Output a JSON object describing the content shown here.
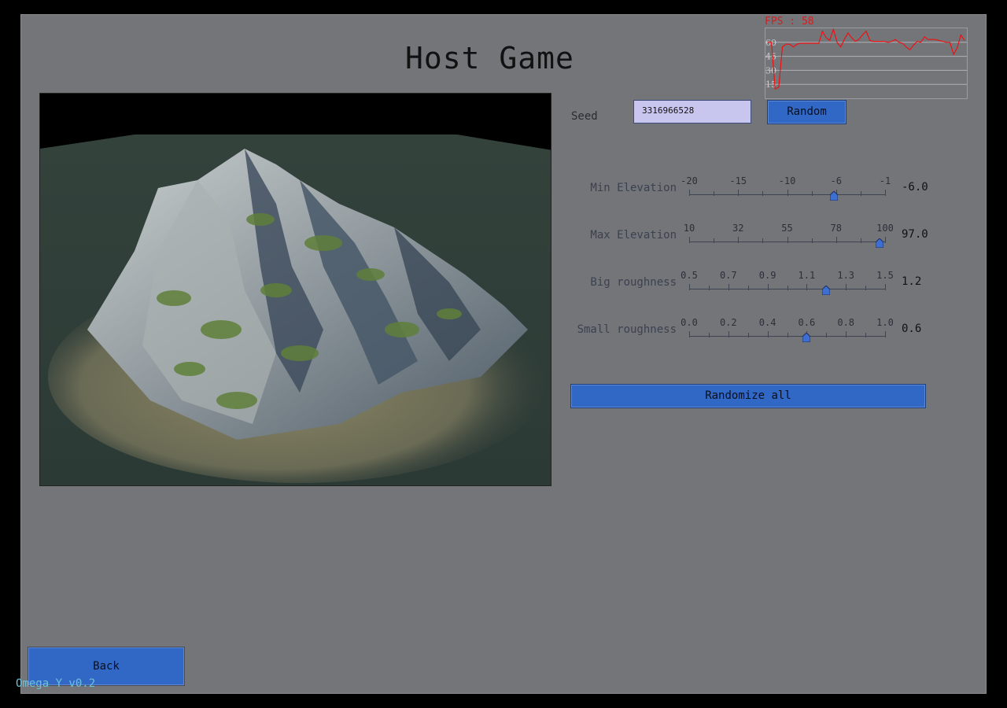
{
  "title": "Host Game",
  "seed": {
    "label": "Seed",
    "value": "3316966528",
    "random_label": "Random"
  },
  "sliders": [
    {
      "label": "Min Elevation",
      "ticks": [
        "-20",
        "-15",
        "-10",
        "-6",
        "-1"
      ],
      "fraction": 0.74,
      "value": "-6.0"
    },
    {
      "label": "Max Elevation",
      "ticks": [
        "10",
        "32",
        "55",
        "78",
        "100"
      ],
      "fraction": 0.97,
      "value": "97.0"
    },
    {
      "label": "Big roughness",
      "ticks": [
        "0.5",
        "0.7",
        "0.9",
        "1.1",
        "1.3",
        "1.5"
      ],
      "fraction": 0.7,
      "value": "1.2"
    },
    {
      "label": "Small roughness",
      "ticks": [
        "0.0",
        "0.2",
        "0.4",
        "0.6",
        "0.8",
        "1.0"
      ],
      "fraction": 0.6,
      "value": "0.6"
    }
  ],
  "randomize_all_label": "Randomize all",
  "back_label": "Back",
  "fps": {
    "label": "FPS : 58",
    "axis_labels": [
      "60",
      "45",
      "30",
      "15"
    ],
    "samples": [
      60,
      60,
      10,
      12,
      55,
      58,
      58,
      55,
      58,
      59,
      59,
      59,
      59,
      59,
      59,
      72,
      65,
      62,
      74,
      60,
      55,
      63,
      70,
      65,
      61,
      63,
      68,
      72,
      62,
      61,
      61,
      61,
      61,
      60,
      61,
      63,
      60,
      59,
      55,
      52,
      57,
      61,
      60,
      66,
      63,
      63,
      63,
      62,
      61,
      60,
      60,
      47,
      54,
      68,
      62
    ]
  },
  "version": "Omega Y v0.2",
  "colors": {
    "background": "#747579",
    "button": "#3168c6",
    "input": "#c8c6ef",
    "fps_line": "#ee1111",
    "knob": "#3d6fd1"
  }
}
